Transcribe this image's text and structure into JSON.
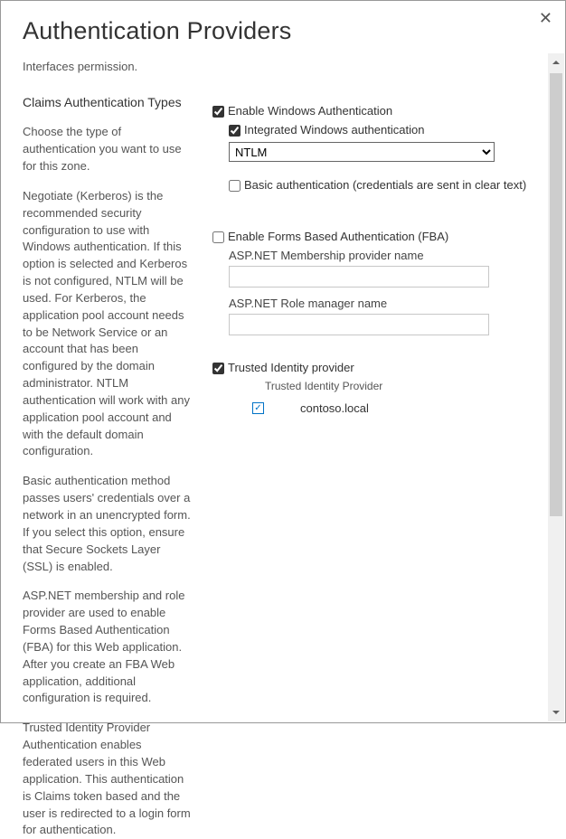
{
  "dialog": {
    "title": "Authentication Providers",
    "close_symbol": "✕",
    "subtitle": "Interfaces permission."
  },
  "left": {
    "heading": "Claims Authentication Types",
    "p1": "Choose the type of authentication you want to use for this zone.",
    "p2": "Negotiate (Kerberos) is the recommended security configuration to use with Windows authentication. If this option is selected and Kerberos is not configured, NTLM will be used. For Kerberos, the application pool account needs to be Network Service or an account that has been configured by the domain administrator. NTLM authentication will work with any application pool account and with the default domain configuration.",
    "p3": "Basic authentication method passes users' credentials over a network in an unencrypted form. If you select this option, ensure that Secure Sockets Layer (SSL) is enabled.",
    "p4": "ASP.NET membership and role provider are used to enable Forms Based Authentication (FBA) for this Web application. After you create an FBA Web application, additional configuration is required.",
    "p5": "Trusted Identity Provider Authentication enables federated users in this Web application. This authentication is Claims token based and the user is redirected to a login form for authentication."
  },
  "right": {
    "enable_windows": {
      "label": "Enable Windows Authentication",
      "checked": true
    },
    "integrated_windows": {
      "label": "Integrated Windows authentication",
      "checked": true
    },
    "ntlm_selected": "NTLM",
    "basic_auth": {
      "label": "Basic authentication (credentials are sent in clear text)",
      "checked": false
    },
    "enable_fba": {
      "label": "Enable Forms Based Authentication (FBA)",
      "checked": false
    },
    "membership_label": "ASP.NET Membership provider name",
    "membership_value": "",
    "role_label": "ASP.NET Role manager name",
    "role_value": "",
    "trusted_provider": {
      "label": "Trusted Identity provider",
      "checked": true
    },
    "trusted_sub_label": "Trusted Identity Provider",
    "trusted_item": {
      "label": "contoso.local",
      "checked": true
    }
  }
}
